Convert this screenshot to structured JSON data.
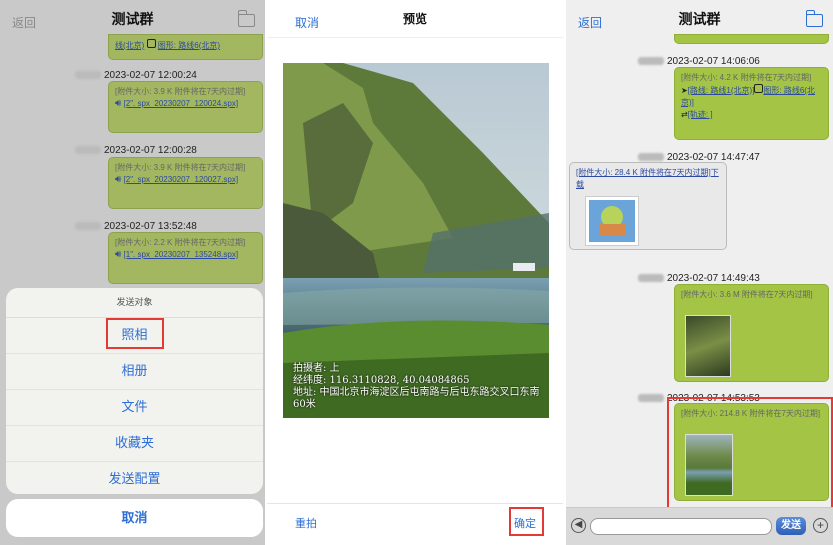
{
  "left": {
    "nav": {
      "back": "返回",
      "title": "测试群"
    },
    "top_bubble": {
      "link1": "线(北京)",
      "link2": "图形: 路线6(北京)"
    },
    "messages": [
      {
        "time": "2023-02-07 12:00:24",
        "meta": "[附件大小: 3.9 K 附件将在7天内过期]",
        "file": "[2\". spx_20230207_120024.spx]"
      },
      {
        "time": "2023-02-07 12:00:28",
        "meta": "[附件大小: 3.9 K 附件将在7天内过期]",
        "file": "[2\". spx_20230207_120027.spx]"
      },
      {
        "time": "2023-02-07 13:52:48",
        "meta": "[附件大小: 2.2 K 附件将在7天内过期]",
        "file": "[1\". spx_20230207_135248.spx]"
      }
    ],
    "sheet": {
      "title": "发送对象",
      "options": [
        "照相",
        "相册",
        "文件",
        "收藏夹",
        "发送配置"
      ],
      "cancel": "取消"
    }
  },
  "middle": {
    "nav": {
      "cancel": "取消",
      "title": "预览"
    },
    "overlay": {
      "line1": "拍摄者: 上",
      "line2": "经纬度: 116.3110828, 40.04084865",
      "line3": "地址: 中国北京市海淀区后屯南路与后屯东路交叉口东南60米"
    },
    "retake": "重拍",
    "confirm": "确定"
  },
  "right": {
    "nav": {
      "back": "返回",
      "title": "测试群"
    },
    "messages": [
      {
        "time": "2023-02-07 14:06:06",
        "meta": "[附件大小: 4.2 K 附件将在7天内过期]",
        "link1": "[路线: 路线1(北京)]",
        "link2": "图形: 路线6(北京)]",
        "link3": "[轨迹: ]"
      },
      {
        "time": "2023-02-07 14:47:47",
        "text": "[附件大小: 28.4 K 附件将在7天内过期]",
        "download": "下载"
      },
      {
        "time": "2023-02-07 14:49:43",
        "meta": "[附件大小: 3.6 M 附件将在7天内过期]"
      },
      {
        "time": "2023-02-07 14:53:53",
        "meta": "[附件大小: 214.8 K 附件将在7天内过期]"
      }
    ],
    "send": "发送"
  },
  "colors": {
    "accent": "#2d6fd6",
    "bubble": "#a3c444",
    "highlight": "#e53935"
  }
}
